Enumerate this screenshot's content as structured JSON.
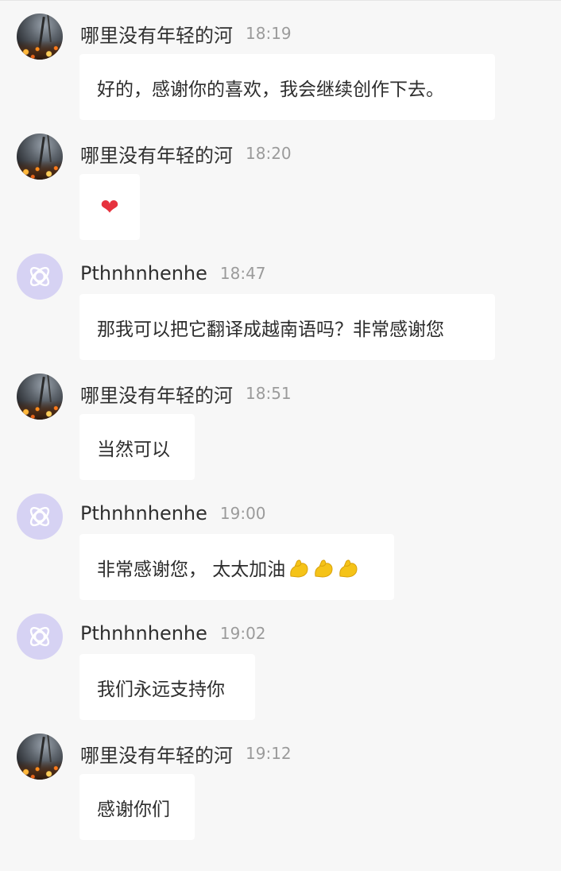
{
  "messages": [
    {
      "sender": "哪里没有年轻的河",
      "time": "18:19",
      "avatar": "photo-avatar",
      "text": "好的，感谢你的喜欢，我会继续创作下去。"
    },
    {
      "sender": "哪里没有年轻的河",
      "time": "18:20",
      "avatar": "photo-avatar",
      "text": "❤"
    },
    {
      "sender": "Pthnhnhenhe",
      "time": "18:47",
      "avatar": "purple-atom-avatar",
      "text": "那我可以把它翻译成越南语吗？非常感谢您"
    },
    {
      "sender": "哪里没有年轻的河",
      "time": "18:51",
      "avatar": "photo-avatar",
      "text": "当然可以"
    },
    {
      "sender": "Pthnhnhenhe",
      "time": "19:00",
      "avatar": "purple-atom-avatar",
      "text": "非常感谢您， 太太加油",
      "emoji": [
        "flexed-biceps-icon",
        "flexed-biceps-icon",
        "flexed-biceps-icon"
      ]
    },
    {
      "sender": "Pthnhnhenhe",
      "time": "19:02",
      "avatar": "purple-atom-avatar",
      "text": "我们永远支持你"
    },
    {
      "sender": "哪里没有年轻的河",
      "time": "19:12",
      "avatar": "photo-avatar",
      "text": "感谢你们"
    }
  ],
  "colors": {
    "background": "#f7f7f7",
    "bubble": "#ffffff",
    "purple_avatar": "#d6d2f3",
    "heart": "#e6323e",
    "emoji": "#f5c318"
  }
}
